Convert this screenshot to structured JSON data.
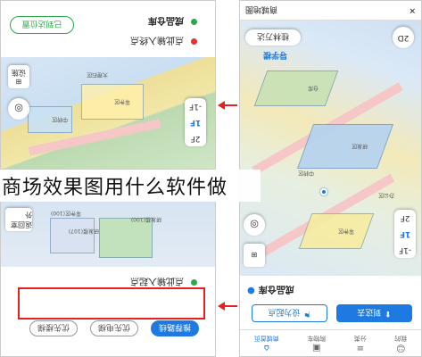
{
  "caption": "商场效果图用什么软件做",
  "top_left": {
    "floors": [
      "2F",
      "1F",
      "-1F"
    ],
    "active_floor": "1F",
    "locate_icon": "target-icon",
    "poi_button": "设施",
    "row1_label": "成品仓库",
    "row1_dot": "#2aa84a",
    "row2_label": "点此输入终点",
    "row2_dot": "#e23232",
    "action_button": "已到达位置",
    "map_labels": [
      "零件区",
      "中转区",
      "大理石区"
    ]
  },
  "bottom_left": {
    "map_labels": [
      "返回室外",
      "研发楼(100)",
      "研发楼(107)",
      "零件区(100)"
    ],
    "row1_label": "点此输入起点",
    "buttons": [
      "推荐路线",
      "优先电梯",
      "优先楼梯"
    ]
  },
  "right": {
    "title": "商城地图",
    "mode_button": "2D",
    "brand_button": "桂林万达",
    "side_label": "导学楼",
    "floors": [
      "2F",
      "1F",
      "-1F"
    ],
    "active_floor": "1F",
    "map_labels": [
      "零件区",
      "研发区",
      "仓库",
      "中转区",
      "办公区"
    ],
    "place_name": "成品仓库",
    "set_start": "设为起点",
    "go_here": "到这去",
    "tabs": [
      "商城首页",
      "购物车",
      "分类",
      "我的"
    ],
    "active_tab": "商城首页"
  }
}
